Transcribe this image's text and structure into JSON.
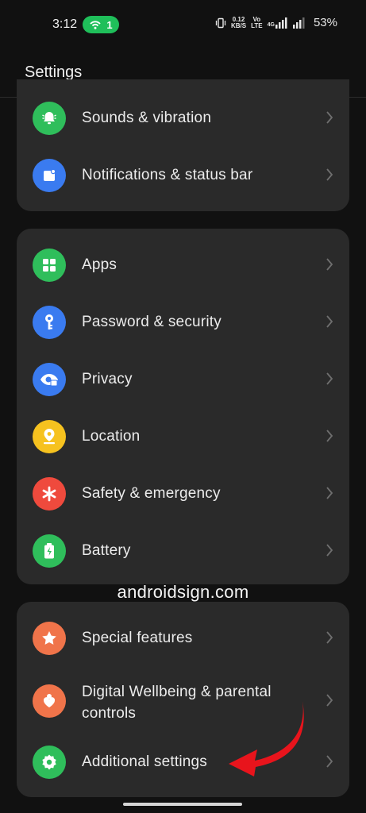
{
  "status_bar": {
    "time": "3:12",
    "hotspot_count": "1",
    "net_speed_value": "0.12",
    "net_speed_unit": "KB/S",
    "volte_top": "Vo",
    "volte_bottom": "LTE",
    "network_type": "4G",
    "battery": "53%"
  },
  "header": {
    "title": "Settings"
  },
  "groups": [
    {
      "items": [
        {
          "label": "Sounds & vibration",
          "icon": "bell-icon",
          "color": "#2fbe5b"
        },
        {
          "label": "Notifications & status bar",
          "icon": "notification-icon",
          "color": "#3a7bf0"
        }
      ]
    },
    {
      "items": [
        {
          "label": "Apps",
          "icon": "apps-grid-icon",
          "color": "#2fbe5b"
        },
        {
          "label": "Password & security",
          "icon": "key-icon",
          "color": "#3a7bf0"
        },
        {
          "label": "Privacy",
          "icon": "privacy-eye-lock-icon",
          "color": "#3a7bf0"
        },
        {
          "label": "Location",
          "icon": "location-pin-icon",
          "color": "#f6c21f"
        },
        {
          "label": "Safety & emergency",
          "icon": "asterisk-icon",
          "color": "#ef4a3d"
        },
        {
          "label": "Battery",
          "icon": "battery-icon",
          "color": "#2fbe5b"
        }
      ]
    },
    {
      "items": [
        {
          "label": "Special features",
          "icon": "star-icon",
          "color": "#f0744a"
        },
        {
          "label": "Digital Wellbeing & parental controls",
          "icon": "wellbeing-heart-icon",
          "color": "#f0744a"
        },
        {
          "label": "Additional settings",
          "icon": "gear-icon",
          "color": "#2fbe5b"
        }
      ]
    }
  ],
  "watermark": "androidsign.com",
  "annotation": {
    "arrow_color": "#e8141c"
  }
}
